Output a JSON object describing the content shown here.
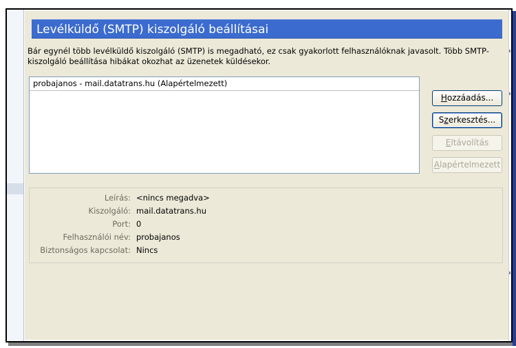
{
  "title": "Levélküldő (SMTP) kiszolgáló beállításai",
  "description": "Bár egynél több levélküldő kiszolgáló (SMTP) is megadható, ez csak gyakorlott felhasználóknak javasolt. Több SMTP-kiszolgáló beállítása hibákat okozhat az üzenetek küldésekor.",
  "servers": [
    "probajanos - mail.datatrans.hu (Alapértelmezett)"
  ],
  "buttons": {
    "add": {
      "pre": "",
      "key": "H",
      "post": "ozzáadás..."
    },
    "edit": {
      "pre": "S",
      "key": "z",
      "post": "erkesztés..."
    },
    "remove": {
      "pre": "",
      "key": "E",
      "post": "ltávolítás"
    },
    "set_default": {
      "pre": "",
      "key": "A",
      "post": "lapértelmezett"
    }
  },
  "details": [
    {
      "label": "Leírás:",
      "value": "<nincs megadva>"
    },
    {
      "label": "Kiszolgáló:",
      "value": "mail.datatrans.hu"
    },
    {
      "label": "Port:",
      "value": "0"
    },
    {
      "label": "Felhasználói név:",
      "value": "probajanos"
    },
    {
      "label": "Biztonságos kapcsolat:",
      "value": "Nincs"
    }
  ],
  "colors": {
    "title_bar": "#3b6bce",
    "panel_bg": "#ece9d8",
    "list_border": "#7f9db9"
  }
}
